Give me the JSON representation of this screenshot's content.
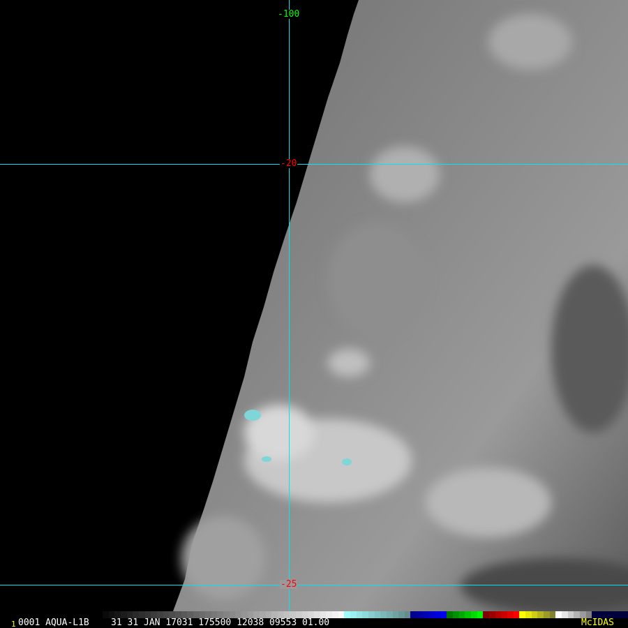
{
  "grid_labels": {
    "lon_top": "-100",
    "lat_upper": "-20",
    "lat_lower": "-25"
  },
  "colors": {
    "grid_line": "#00e5f0",
    "lon_label": "#00ff00",
    "lat_label": "#ff0000",
    "logo": "#ffff00"
  },
  "footer": {
    "frame_number": "1",
    "info": "0001 AQUA-L1B    31 31 JAN 17031 175500 12038 09553 01.00",
    "logo": "McIDAS"
  }
}
